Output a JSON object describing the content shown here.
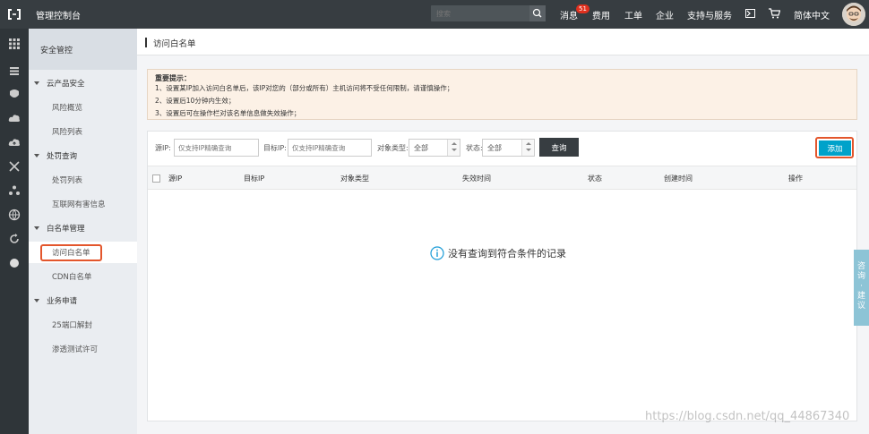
{
  "topbar": {
    "title": "管理控制台",
    "search_placeholder": "搜索",
    "messages_label": "消息",
    "messages_count": "51",
    "items": [
      "费用",
      "工单",
      "企业",
      "支持与服务"
    ],
    "language": "简体中文",
    "icons": [
      "aliyun-logo-icon",
      "search-icon",
      "terminal-icon",
      "cart-icon",
      "avatar"
    ]
  },
  "rail": {
    "icons": [
      "grid-icon",
      "list-icon",
      "shield-icon",
      "cloud-icon",
      "cloud-upload-icon",
      "network-icon",
      "cluster-icon",
      "globe-icon",
      "refresh-icon",
      "circle-icon"
    ]
  },
  "subnav": {
    "header": "安全管控",
    "groups": [
      {
        "title": "云产品安全",
        "items": [
          "风险概览",
          "风险列表"
        ]
      },
      {
        "title": "处罚查询",
        "items": [
          "处罚列表",
          "互联网有害信息"
        ]
      },
      {
        "title": "白名单管理",
        "items": [
          "访问白名单",
          "CDN白名单"
        ]
      },
      {
        "title": "业务申请",
        "items": [
          "25端口解封",
          "渗透测试许可"
        ]
      }
    ],
    "active_item": "访问白名单"
  },
  "main": {
    "page_title": "访问白名单",
    "notice": {
      "title": "重要提示：",
      "lines": [
        "1、设置某IP加入访问白名单后，该IP对您的（部分或所有）主机访问将不受任何限制，请谨慎操作；",
        "2、设置后10分钟内生效；",
        "3、设置后可在操作栏对该名单信息做失效操作；"
      ]
    },
    "filters": {
      "source_ip_label": "源IP:",
      "source_ip_placeholder": "仅支持IP精确查询",
      "target_ip_label": "目标IP:",
      "target_ip_placeholder": "仅支持IP精确查询",
      "object_type_label": "对象类型:",
      "object_type_value": "全部",
      "status_label": "状态:",
      "status_value": "全部",
      "query_button": "查询",
      "add_button": "添加"
    },
    "table": {
      "columns": [
        "源IP",
        "目标IP",
        "对象类型",
        "失效时间",
        "状态",
        "创建时间",
        "操作"
      ],
      "rows": [],
      "empty_text": "没有查询到符合条件的记录"
    }
  },
  "feedback": {
    "label": "咨询·建议"
  },
  "watermark": "https://blog.csdn.net/qq_44867340",
  "colors": {
    "topbar": "#373d41",
    "rail": "#2f3539",
    "accent": "#00a2ca",
    "highlight": "#e3562c",
    "notice_bg": "#fcf1e6"
  }
}
